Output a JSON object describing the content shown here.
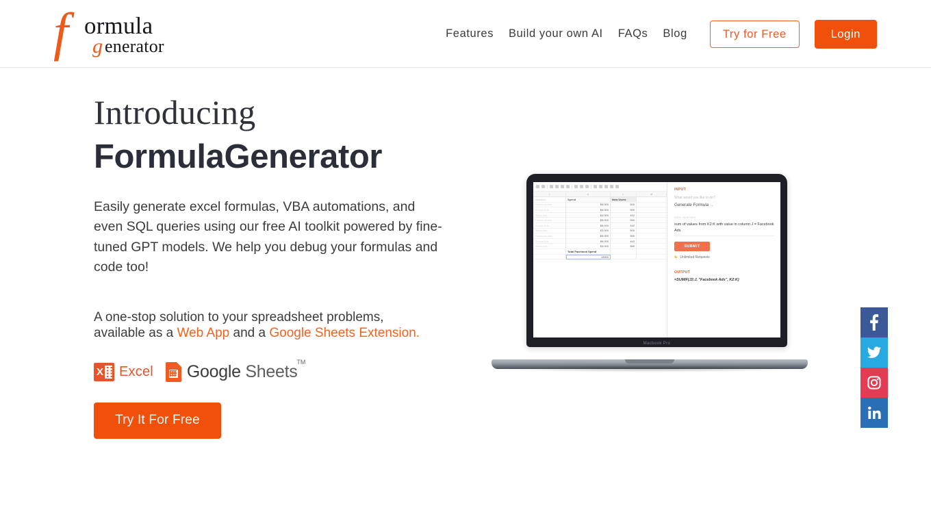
{
  "brand": {
    "logo_f": "f",
    "logo_ormula": "ormula",
    "logo_g": "g",
    "logo_enerator": "enerator",
    "accent_orange": "#f1500a",
    "link_orange": "#f1641f"
  },
  "nav": {
    "links": [
      {
        "label": "Features",
        "name": "nav-link-features"
      },
      {
        "label": "Build your own AI",
        "name": "nav-link-build-your-own-ai"
      },
      {
        "label": "FAQs",
        "name": "nav-link-faqs"
      },
      {
        "label": "Blog",
        "name": "nav-link-blog"
      }
    ],
    "try_free_label": "Try for Free",
    "login_label": "Login"
  },
  "hero": {
    "eyebrow": "Introducing",
    "title": "FormulaGenerator",
    "lede": "Easily generate excel formulas, VBA automations, and even SQL queries using our free AI toolkit powered by fine-tuned GPT models. We help you debug your formulas and code too!",
    "subline_part1": "A one-stop solution to your spreadsheet problems, available as a ",
    "subline_link1": "Web App",
    "subline_part2": " and a ",
    "subline_link2": "Google Sheets Extension.",
    "cta_label": "Try It For Free",
    "excel_x": "X",
    "excel_label": "Excel",
    "gsheets_google": "Google",
    "gsheets_sheets": " Sheets",
    "gsheets_tm": "TM"
  },
  "laptop": {
    "model_label": "Macbook Pro",
    "spreadsheet": {
      "column_headers": [
        "J",
        "K",
        "L",
        "M"
      ],
      "header_row": [
        "Channel",
        "Spend",
        "New Users",
        ""
      ],
      "rows": [
        [
          "Facebook Ads",
          "$5,000",
          "500",
          ""
        ],
        [
          "Google Ads",
          "$6,000",
          "559",
          ""
        ],
        [
          "Tiktok Ads",
          "$3,000",
          "442",
          ""
        ],
        [
          "Facebook Ads",
          "$5,000",
          "559",
          ""
        ],
        [
          "Google Ads",
          "$6,000",
          "442",
          ""
        ],
        [
          "Tiktok Ads",
          "$3,000",
          "500",
          ""
        ],
        [
          "Facebook Ads",
          "$5,000",
          "559",
          ""
        ],
        [
          "Google Ads",
          "$6,000",
          "442",
          ""
        ],
        [
          "Tiktok Ads",
          "$3,000",
          "559",
          ""
        ]
      ],
      "total_label": "Total Facebook Spend",
      "total_value": "15000"
    },
    "app": {
      "input_heading": "INPUT",
      "question": "What would you like to do?",
      "selected_mode": "Generate Formula",
      "caret": "⌄",
      "input_placeholder": "Enter input here",
      "input_value": "sum of values from K2:K with value in column J = Facebook Ads",
      "submit_label": "SUBMIT",
      "unlimited_label": "Unlimited Requests",
      "output_heading": "OUTPUT",
      "output_value": "=SUMIF(J2:J, \"Facebook Ads\", K2:K)"
    }
  },
  "social": [
    {
      "name": "facebook-icon",
      "label": "Facebook",
      "color": "#3b5998"
    },
    {
      "name": "twitter-icon",
      "label": "Twitter",
      "color": "#29a9e1"
    },
    {
      "name": "instagram-icon",
      "label": "Instagram",
      "color": "#e23b54"
    },
    {
      "name": "linkedin-icon",
      "label": "LinkedIn",
      "color": "#2a6fb5"
    }
  ]
}
